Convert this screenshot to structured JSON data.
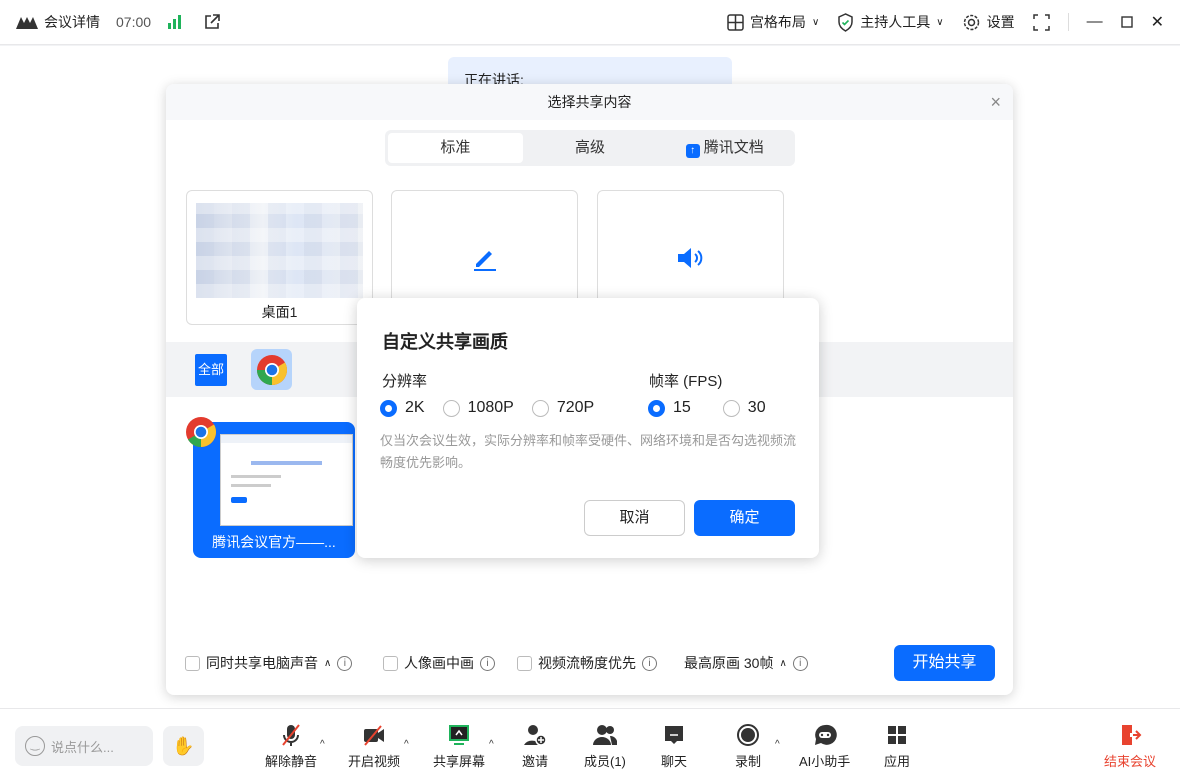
{
  "topbar": {
    "meeting_details": "会议详情",
    "time": "07:00",
    "layout": "宫格布局",
    "host_tools": "主持人工具",
    "settings": "设置"
  },
  "speaking": "正在讲话:",
  "dialog": {
    "title": "选择共享内容",
    "tabs": [
      {
        "label": "标准",
        "active": true
      },
      {
        "label": "高级"
      },
      {
        "label": "腾讯文档"
      }
    ],
    "cards": [
      {
        "label": "桌面1"
      }
    ],
    "filter_all": "全部",
    "window_title": "腾讯会议官方——...",
    "options": [
      {
        "label": "同时共享电脑声音",
        "checked": false
      },
      {
        "label": "人像画中画",
        "checked": false
      },
      {
        "label": "视频流畅度优先",
        "checked": false
      }
    ],
    "quality": "最高原画 30帧",
    "start_share": "开始共享"
  },
  "popup": {
    "title": "自定义共享画质",
    "resolution_label": "分辨率",
    "resolutions": [
      "2K",
      "1080P",
      "720P"
    ],
    "resolution_selected": "2K",
    "fps_label": "帧率 (FPS)",
    "fps": [
      "15",
      "30"
    ],
    "fps_selected": "15",
    "note": "仅当次会议生效，实际分辨率和帧率受硬件、网络环境和是否勾选视频流畅度优先影响。",
    "cancel": "取消",
    "confirm": "确定"
  },
  "bottombar": {
    "chat_placeholder": "说点什么...",
    "items": [
      "解除静音",
      "开启视频",
      "共享屏幕",
      "邀请",
      "成员(1)",
      "聊天",
      "录制",
      "AI小助手",
      "应用"
    ],
    "end": "结束会议"
  },
  "colors": {
    "accent": "#0a6cff",
    "end": "#e8432f",
    "signal": "#1fb35b"
  }
}
